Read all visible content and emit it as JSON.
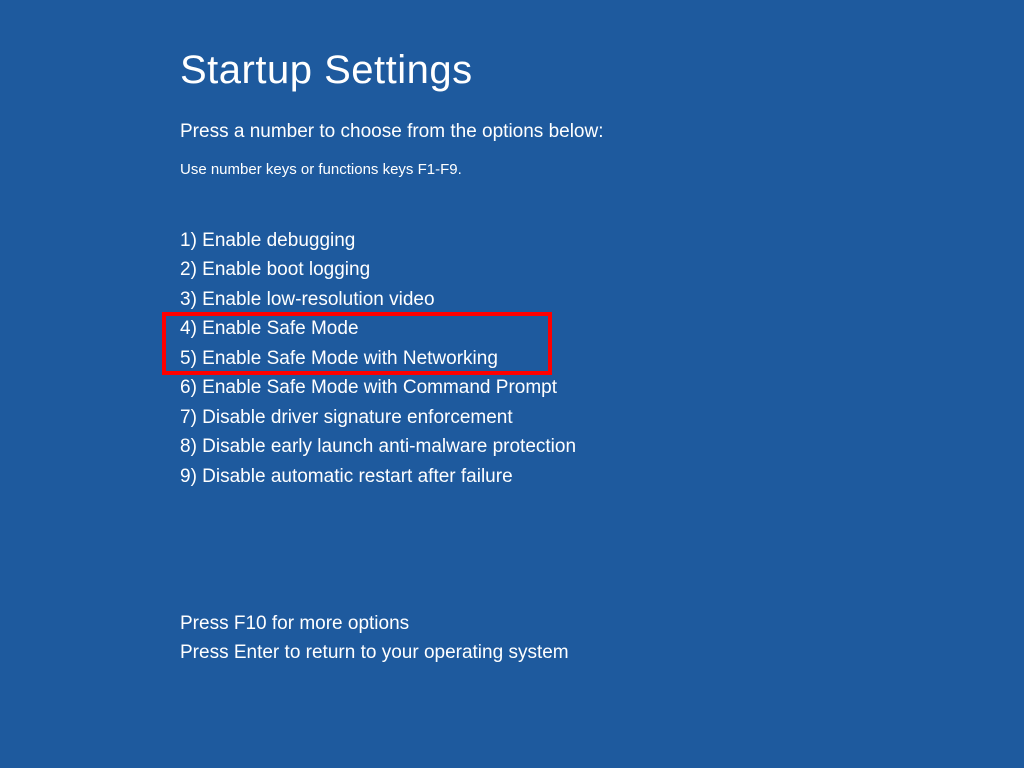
{
  "title": "Startup Settings",
  "subtitle": "Press a number to choose from the options below:",
  "hint": "Use number keys or functions keys F1-F9.",
  "options": [
    "1) Enable debugging",
    "2) Enable boot logging",
    "3) Enable low-resolution video",
    "4) Enable Safe Mode",
    "5) Enable Safe Mode with Networking",
    "6) Enable Safe Mode with Command Prompt",
    "7) Disable driver signature enforcement",
    "8) Disable early launch anti-malware protection",
    "9) Disable automatic restart after failure"
  ],
  "footer": {
    "more_options": "Press F10 for more options",
    "return": "Press Enter to return to your operating system"
  }
}
